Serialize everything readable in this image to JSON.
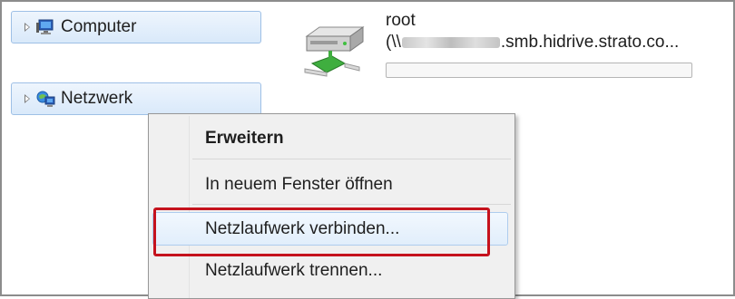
{
  "navigation": {
    "items": [
      {
        "label": "Computer",
        "icon": "computer-icon"
      },
      {
        "label": "Netzwerk",
        "icon": "network-icon"
      }
    ]
  },
  "drive": {
    "name": "root",
    "path_prefix": "(\\\\",
    "path_suffix": ".smb.hidrive.strato.co...",
    "icon": "network-drive-icon",
    "usage_fraction": 0.0
  },
  "context_menu": {
    "items": [
      {
        "label": "Erweitern",
        "bold": true
      },
      {
        "label": "In neuem Fenster öffnen"
      },
      {
        "label": "Netzlaufwerk verbinden...",
        "highlighted": true
      },
      {
        "label": "Netzlaufwerk trennen..."
      }
    ]
  },
  "colors": {
    "highlight": "#c5121d",
    "nav_border": "#9ec0e6"
  }
}
